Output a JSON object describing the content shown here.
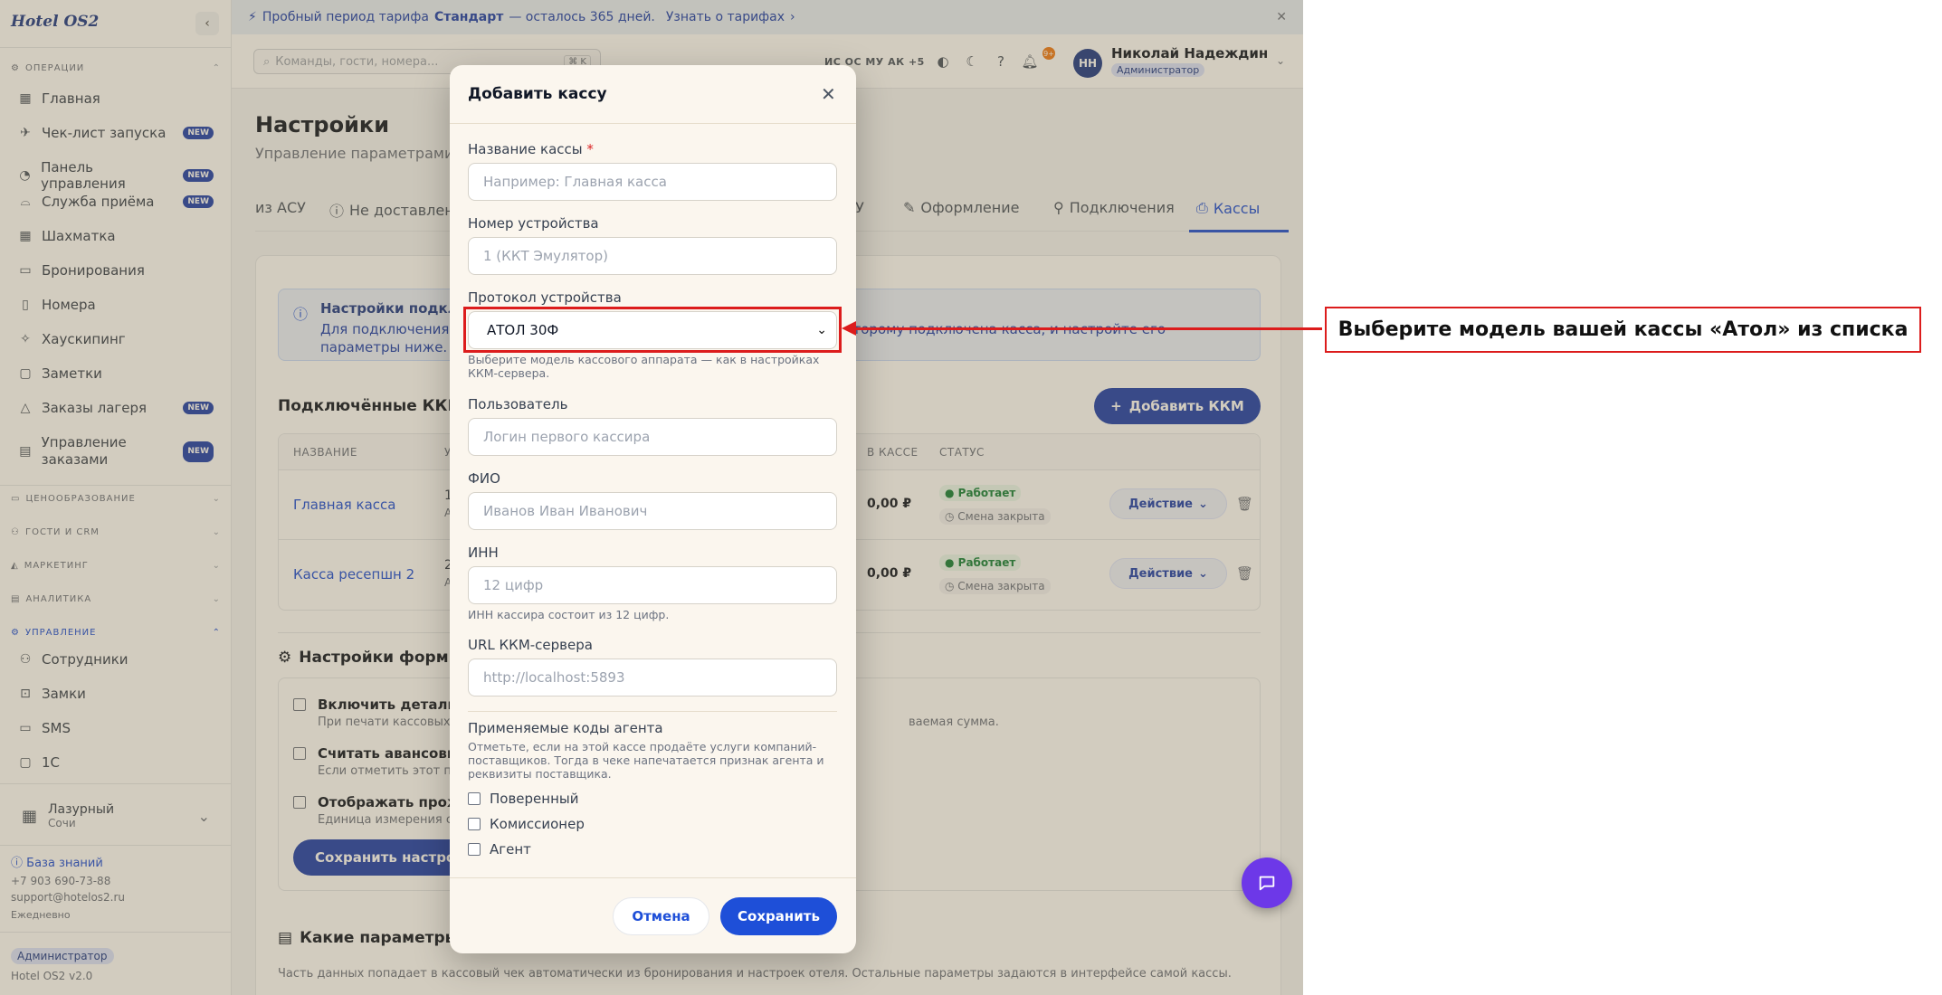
{
  "app": {
    "brand": "Hotel OS2"
  },
  "banner": {
    "text_prefix": "Пробный период тарифа ",
    "plan": "Стандарт",
    "text_suffix": " — осталось 365 дней.",
    "link": "Узнать о тарифах"
  },
  "search": {
    "placeholder": "Команды, гости, номера...",
    "shortcut": "⌘ K"
  },
  "topbar": {
    "presence": "ИС ОС МУ АК +5",
    "notifications": "9+"
  },
  "user": {
    "initials": "НН",
    "name": "Николай Надеждин",
    "role": "Администратор"
  },
  "sidebar": {
    "sections": {
      "operations": "ОПЕРАЦИИ",
      "pricing": "ЦЕНООБРАЗОВАНИЕ",
      "guests": "ГОСТИ И CRM",
      "marketing": "МАРКЕТИНГ",
      "analytics": "АНАЛИТИКА",
      "management": "УПРАВЛЕНИЕ"
    },
    "new_badge": "NEW",
    "ops_items": [
      {
        "label": "Главная",
        "icon": "dashboard-icon"
      },
      {
        "label": "Чек-лист запуска",
        "icon": "rocket-icon",
        "new": true
      },
      {
        "label": "Панель управления",
        "icon": "gauge-icon",
        "new": true
      },
      {
        "label": "Служба приёма",
        "icon": "bell-desk-icon",
        "new": true
      },
      {
        "label": "Шахматка",
        "icon": "grid-icon"
      },
      {
        "label": "Бронирования",
        "icon": "calendar-icon"
      },
      {
        "label": "Номера",
        "icon": "door-icon"
      },
      {
        "label": "Хаускипинг",
        "icon": "sparkle-icon"
      },
      {
        "label": "Заметки",
        "icon": "note-icon"
      },
      {
        "label": "Заказы лагеря",
        "icon": "tent-icon",
        "new": true
      },
      {
        "label": "Управление заказами",
        "icon": "clipboard-icon",
        "new": true
      }
    ],
    "mgmt_items": [
      {
        "label": "Сотрудники",
        "icon": "users-icon"
      },
      {
        "label": "Замки",
        "icon": "lock-icon"
      },
      {
        "label": "SMS",
        "icon": "message-icon"
      },
      {
        "label": "1С",
        "icon": "doc-icon"
      }
    ],
    "hotel": {
      "name": "Лазурный",
      "city": "Сочи"
    },
    "knowledge_base": "База знаний",
    "phone": "+7 903 690-73-88",
    "email": "support@hotelos2.ru",
    "hours": "Ежедневно",
    "role": "Администратор",
    "version": "Hotel OS2 v2.0"
  },
  "page": {
    "title": "Настройки",
    "subtitle": "Управление параметрами отеля"
  },
  "tabs": [
    {
      "label": "из АСУ",
      "icon": "",
      "active": false
    },
    {
      "label": "Не доставлено",
      "icon": "ⓘ",
      "active": false
    },
    {
      "label": "СУ",
      "icon": "",
      "active": false
    },
    {
      "label": "Оформление",
      "icon": "✎",
      "active": false
    },
    {
      "label": "Подключения",
      "icon": "⚲",
      "active": false
    },
    {
      "label": "Кассы",
      "icon": "⎙",
      "active": true
    }
  ],
  "info": {
    "title": "Настройки подключения",
    "body": "Для подключения ваших касс укажите адрес сервера на компьютер, к которому подключена касса, и настройте его параметры ниже."
  },
  "kkm": {
    "heading": "Подключённые ККМ",
    "add_button": "Добавить ККМ",
    "columns": [
      "НАЗВАНИЕ",
      "У",
      "В КАССЕ",
      "СТАТУС"
    ],
    "rows": [
      {
        "name": "Главная касса",
        "num": "1",
        "sub": "А",
        "amount": "0,00 ₽",
        "status": "Работает",
        "shift": "Смена закрыта",
        "action": "Действие"
      },
      {
        "name": "Касса ресепшн 2",
        "num": "2",
        "sub": "А",
        "amount": "0,00 ₽",
        "status": "Работает",
        "shift": "Смена закрыта",
        "action": "Действие"
      }
    ]
  },
  "receipt": {
    "heading": "Настройки формирования чеков",
    "options": [
      {
        "title": "Включить детализацию",
        "sub": "При печати кассовых чеков",
        "sub_tail": "ваемая сумма."
      },
      {
        "title": "Считать авансовым",
        "sub": "Если отметить этот пункт"
      },
      {
        "title": "Отображать прожив",
        "sub": "Единица измерения стат"
      }
    ],
    "save": "Сохранить настройки"
  },
  "params": {
    "heading": "Какие параметры передаются",
    "sub": "Часть данных попадает в кассовый чек автоматически из бронирования и настроек отеля. Остальные параметры задаются в интерфейсе самой кассы."
  },
  "modal": {
    "title": "Добавить кассу",
    "name_label": "Название кассы",
    "name_placeholder": "Например: Главная касса",
    "device_label": "Номер устройства",
    "device_placeholder": "1 (ККТ Эмулятор)",
    "protocol_label": "Протокол устройства",
    "protocol_value": "АТОЛ 30Ф",
    "protocol_help": "Выберите модель кассового аппарата — как в настройках ККМ-сервера.",
    "user_label": "Пользователь",
    "user_placeholder": "Логин первого кассира",
    "fio_label": "ФИО",
    "fio_placeholder": "Иванов Иван Иванович",
    "inn_label": "ИНН",
    "inn_placeholder": "12 цифр",
    "inn_help": "ИНН кассира состоит из 12 цифр.",
    "url_label": "URL ККМ-сервера",
    "url_placeholder": "http://localhost:5893",
    "agent_title": "Применяемые коды агента",
    "agent_help": "Отметьте, если на этой кассе продаёте услуги компаний-поставщиков. Тогда в чеке напечатается признак агента и реквизиты поставщика.",
    "agents": [
      "Поверенный",
      "Комиссионер",
      "Агент"
    ],
    "cancel": "Отмена",
    "save": "Сохранить"
  },
  "annotation": {
    "callout": "Выберите модель вашей кассы «Атол» из списка",
    "color": "#dc1c1c"
  },
  "colors": {
    "accent": "#1e4fd8",
    "brand_dark": "#1e40af",
    "chat": "#6d38e8"
  }
}
